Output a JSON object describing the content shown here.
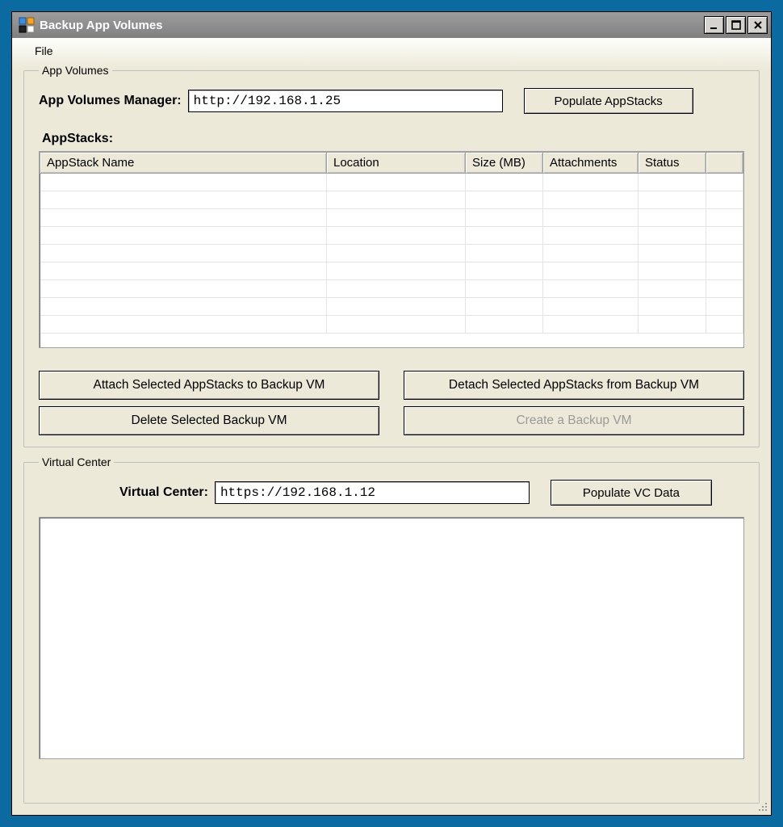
{
  "window": {
    "title": "Backup App Volumes"
  },
  "menubar": {
    "file": "File"
  },
  "appVolumes": {
    "legend": "App Volumes",
    "managerLabel": "App Volumes Manager:",
    "managerValue": "http://192.168.1.25",
    "populateBtn": "Populate AppStacks",
    "appstacksLabel": "AppStacks:",
    "columns": {
      "name": "AppStack Name",
      "location": "Location",
      "size": "Size (MB)",
      "attachments": "Attachments",
      "status": "Status"
    },
    "rows": [],
    "buttons": {
      "attach": "Attach Selected AppStacks to Backup VM",
      "detach": "Detach Selected AppStacks from Backup VM",
      "delete": "Delete Selected Backup VM",
      "create": "Create a Backup VM"
    }
  },
  "virtualCenter": {
    "legend": "Virtual Center",
    "label": "Virtual Center:",
    "value": "https://192.168.1.12",
    "populateBtn": "Populate VC Data"
  }
}
